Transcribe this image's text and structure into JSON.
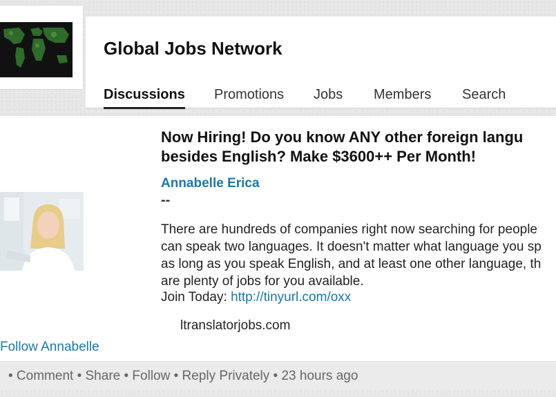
{
  "group": {
    "logo_icon": "world-map-icon",
    "title": "Global Jobs Network"
  },
  "tabs": [
    {
      "label": "Discussions",
      "active": true
    },
    {
      "label": "Promotions",
      "active": false
    },
    {
      "label": "Jobs",
      "active": false
    },
    {
      "label": "Members",
      "active": false
    },
    {
      "label": "Search",
      "active": false
    }
  ],
  "post": {
    "title_line1": "Now Hiring! Do you know ANY other foreign langu",
    "title_line2": "besides English? Make $3600++ Per Month!",
    "author": "Annabelle Erica",
    "dashes": "--",
    "body_lines": [
      "There are hundreds of companies right now searching for people",
      "can speak two languages. It doesn't matter what language you sp",
      "as long as you speak English, and at least one other language, th",
      "are plenty of jobs for you available."
    ],
    "join_label": "Join Today:",
    "join_link": "http://tinyurl.com/oxx",
    "domain_text": "ltranslatorjobs.com",
    "follow_label": "Follow Annabelle",
    "author_avatar": "author-photo"
  },
  "footer": {
    "comment": "• Comment",
    "share": "• Share",
    "follow": "• Follow",
    "reply": "• Reply Privately",
    "time": "• 23 hours ago"
  },
  "colors": {
    "link": "#1a78a8",
    "background": "#e7e7e7"
  }
}
